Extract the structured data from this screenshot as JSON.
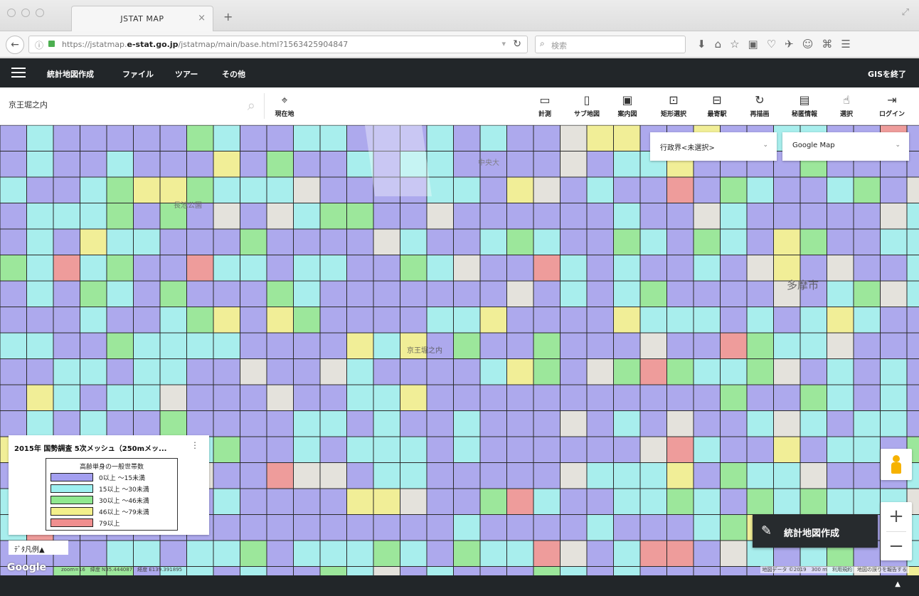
{
  "browser": {
    "tab_title": "JSTAT MAP",
    "tab_close": "×",
    "new_tab": "+",
    "url_info": "ⓘ",
    "url_prefix": "https://jstatmap.",
    "url_domain": "e-stat.go.jp",
    "url_path": "/jstatmap/main/base.html?1563425904847",
    "search_placeholder": "検索"
  },
  "app": {
    "menu": [
      "統計地図作成",
      "ファイル",
      "ツアー",
      "その他"
    ],
    "exit_gis": "GISを終了"
  },
  "search": {
    "value": "京王堀之内"
  },
  "tools": {
    "current_location": "現在地",
    "measure": "計測",
    "sub_map": "サブ地図",
    "guide_map": "案内図",
    "rect_select": "矩形選択",
    "commute": "最寄駅",
    "redraw": "再描画",
    "secret_info": "秘匿情報",
    "select": "選択",
    "login": "ログイン"
  },
  "map": {
    "admin_select": "行政界<未選択>",
    "basemap_select": "Google Map",
    "labels": {
      "park1": "長池公園",
      "city": "多摩市",
      "station1": "京王堀之内",
      "univ": "中央大"
    },
    "legend": {
      "title": "2015年 国勢調査 5次メッシュ（250mメッ...",
      "menu": "⋮",
      "header": "高齢単身の一般世帯数",
      "items": [
        {
          "label": "0以上 ～15未満",
          "color": "#a39ff0"
        },
        {
          "label": "15以上 ～30未満",
          "color": "#9ef0f0"
        },
        {
          "label": "30以上 ～46未満",
          "color": "#8fe88f"
        },
        {
          "label": "46以上 ～79未満",
          "color": "#f3f08b"
        },
        {
          "label": "79以上",
          "color": "#f08f8f"
        }
      ],
      "toggle": "ﾃﾞﾀ凡例▲"
    },
    "google": "Google",
    "coords": "zoom=16　緯度 N35.444087　経度 E139.391895",
    "attribution": "地図データ ©2019　300 m　利用規約　地図の誤りを報告する",
    "create_button": "統計地図作成",
    "zoom_in": "+",
    "zoom_out": "−"
  },
  "footer": {
    "toggle": "▲"
  }
}
